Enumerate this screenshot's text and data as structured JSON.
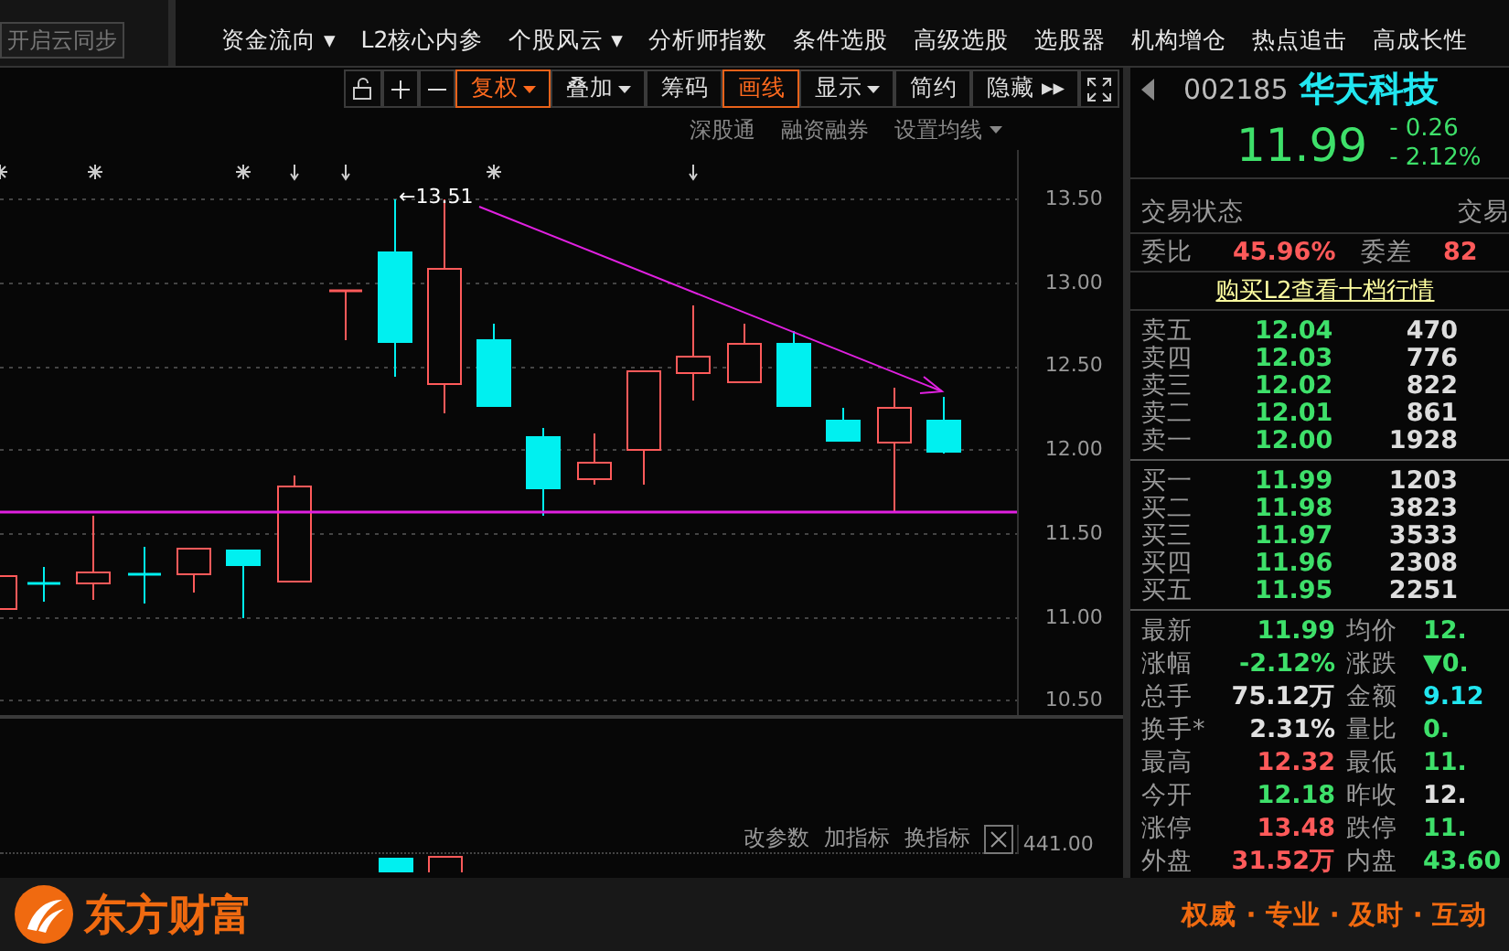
{
  "cloud_sync_button": "开启云同步",
  "menu": [
    "资金流向 ▾",
    "L2核心内参",
    "个股风云 ▾",
    "分析师指数",
    "条件选股",
    "高级选股",
    "选股器",
    "机构增仓",
    "热点追击",
    "高成长性"
  ],
  "toolbar": [
    {
      "kind": "unlock",
      "selected": false
    },
    {
      "kind": "plus",
      "selected": false
    },
    {
      "kind": "minus",
      "selected": false
    },
    {
      "kind": "text",
      "label": "复权",
      "dropdown": true,
      "selected": true
    },
    {
      "kind": "text",
      "label": "叠加",
      "dropdown": true,
      "selected": false
    },
    {
      "kind": "text",
      "label": "筹码",
      "dropdown": false,
      "selected": false
    },
    {
      "kind": "text",
      "label": "画线",
      "dropdown": false,
      "selected": true
    },
    {
      "kind": "text",
      "label": "显示",
      "dropdown": true,
      "selected": false
    },
    {
      "kind": "text",
      "label": "简约",
      "dropdown": false,
      "selected": false
    },
    {
      "kind": "text",
      "label": "隐藏 ▸▸",
      "dropdown": false,
      "selected": false
    },
    {
      "kind": "fullscreen",
      "selected": false
    }
  ],
  "chart_links": [
    {
      "label": "深股通",
      "dropdown": false
    },
    {
      "label": "融资融券",
      "dropdown": false
    },
    {
      "label": "设置均线",
      "dropdown": true
    }
  ],
  "chart": {
    "high_label": "←13.51",
    "y_axis": [
      "13.50",
      "13.00",
      "12.50",
      "12.00",
      "11.50",
      "11.00",
      "10.50"
    ]
  },
  "indicator_panel": {
    "actions": [
      "改参数",
      "加指标",
      "换指标"
    ],
    "axis_label": "441.00"
  },
  "quote": {
    "code": "002185",
    "name": "华天科技",
    "price": "11.99",
    "change": "- 0.26",
    "change_pct": "- 2.12%"
  },
  "status_row": {
    "label": "交易状态",
    "value": "交易"
  },
  "ratio_row": {
    "label": "委比",
    "value": "45.96%",
    "label2": "委差",
    "value2": "82"
  },
  "l2_link": "购买L2查看十档行情",
  "asks": [
    {
      "label": "卖五",
      "price": "12.04",
      "volume": "470"
    },
    {
      "label": "卖四",
      "price": "12.03",
      "volume": "776"
    },
    {
      "label": "卖三",
      "price": "12.02",
      "volume": "822"
    },
    {
      "label": "卖二",
      "price": "12.01",
      "volume": "861"
    },
    {
      "label": "卖一",
      "price": "12.00",
      "volume": "1928"
    }
  ],
  "bids": [
    {
      "label": "买一",
      "price": "11.99",
      "volume": "1203"
    },
    {
      "label": "买二",
      "price": "11.98",
      "volume": "3823"
    },
    {
      "label": "买三",
      "price": "11.97",
      "volume": "3533"
    },
    {
      "label": "买四",
      "price": "11.96",
      "volume": "2308"
    },
    {
      "label": "买五",
      "price": "11.95",
      "volume": "2251"
    }
  ],
  "stats": [
    {
      "label": "最新",
      "value": "11.99",
      "color": "#3ee06a"
    },
    {
      "label": "均价",
      "value": "12.",
      "color": "#3ee06a"
    },
    {
      "label": "涨幅",
      "value": "-2.12%",
      "color": "#3ee06a"
    },
    {
      "label": "涨跌",
      "value": "▼0.",
      "color": "#3ee06a"
    },
    {
      "label": "总手",
      "value": "75.12万",
      "color": "#e0e0e0"
    },
    {
      "label": "金额",
      "value": "9.12",
      "color": "#21e6f0"
    },
    {
      "label": "换手*",
      "value": "2.31%",
      "color": "#e0e0e0"
    },
    {
      "label": "量比",
      "value": "0.",
      "color": "#3ee06a"
    },
    {
      "label": "最高",
      "value": "12.32",
      "color": "#ff5a5a"
    },
    {
      "label": "最低",
      "value": "11.",
      "color": "#3ee06a"
    },
    {
      "label": "今开",
      "value": "12.18",
      "color": "#3ee06a"
    },
    {
      "label": "昨收",
      "value": "12.",
      "color": "#e0e0e0"
    },
    {
      "label": "涨停",
      "value": "13.48",
      "color": "#ff5a5a"
    },
    {
      "label": "跌停",
      "value": "11.",
      "color": "#3ee06a"
    },
    {
      "label": "外盘",
      "value": "31.52万",
      "color": "#ff5a5a"
    },
    {
      "label": "内盘",
      "value": "43.60",
      "color": "#3ee06a"
    }
  ],
  "footer": {
    "brand": "东方财富",
    "slogan": "权威 · 专业 · 及时 · 互动"
  }
}
